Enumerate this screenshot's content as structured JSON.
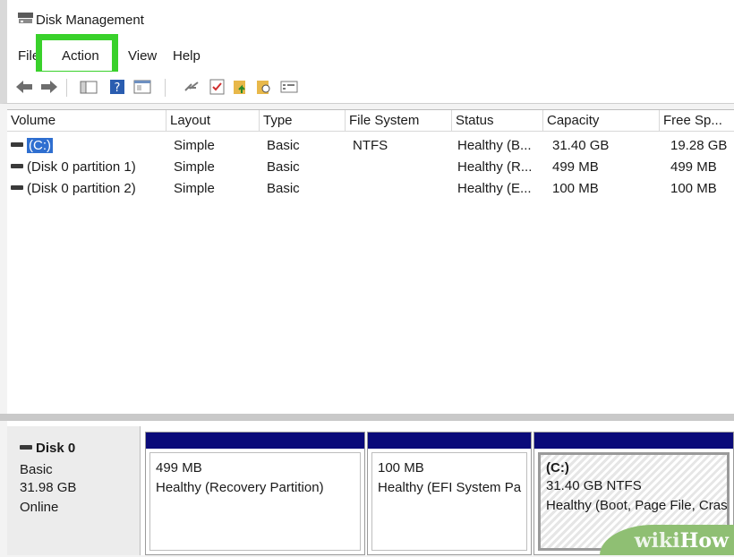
{
  "window": {
    "title": "Disk Management"
  },
  "menu": {
    "items": [
      "File",
      "Action",
      "View",
      "Help"
    ]
  },
  "toolbar": {
    "icons": [
      "back-arrow-icon",
      "forward-arrow-icon",
      "console-tree-icon",
      "help-icon",
      "properties-icon",
      "connect-icon",
      "check-icon",
      "folder-up-icon",
      "folder-search-icon",
      "list-view-icon"
    ]
  },
  "volumes": {
    "headers": [
      "Volume",
      "Layout",
      "Type",
      "File System",
      "Status",
      "Capacity",
      "Free Sp..."
    ],
    "rows": [
      {
        "volume": "(C:)",
        "layout": "Simple",
        "type": "Basic",
        "fs": "NTFS",
        "status": "Healthy (B...",
        "capacity": "31.40 GB",
        "free": "19.28 GB",
        "selected": true
      },
      {
        "volume": "(Disk 0 partition 1)",
        "layout": "Simple",
        "type": "Basic",
        "fs": "",
        "status": "Healthy (R...",
        "capacity": "499 MB",
        "free": "499 MB",
        "selected": false
      },
      {
        "volume": "(Disk 0 partition 2)",
        "layout": "Simple",
        "type": "Basic",
        "fs": "",
        "status": "Healthy (E...",
        "capacity": "100 MB",
        "free": "100 MB",
        "selected": false
      }
    ]
  },
  "disk": {
    "name": "Disk 0",
    "kind": "Basic",
    "size": "31.98 GB",
    "state": "Online",
    "partitions": [
      {
        "line1": "499 MB",
        "line2": "Healthy (Recovery Partition)"
      },
      {
        "line1": "100 MB",
        "line2": "Healthy (EFI System Pa"
      },
      {
        "title": "(C:)",
        "line1": "31.40 GB NTFS",
        "line2": "Healthy (Boot, Page File, Cras"
      }
    ]
  },
  "colors": {
    "highlight": "#39d12b",
    "partition_bar": "#0b0b7a",
    "selection": "#2f6fd0"
  },
  "watermark": {
    "part1": "wiki",
    "part2": "How"
  }
}
